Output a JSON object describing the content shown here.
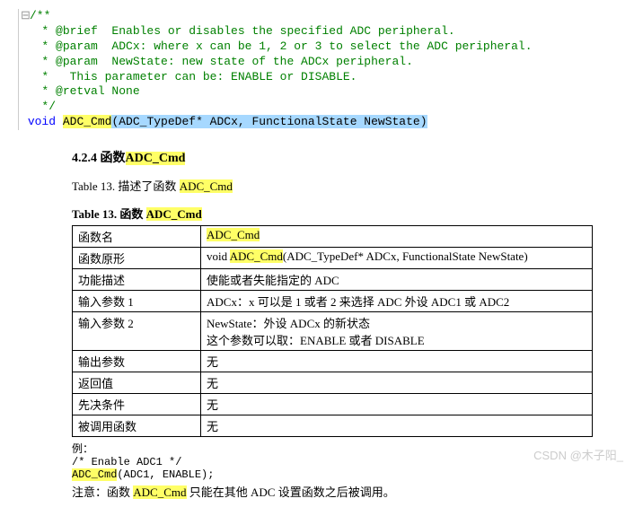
{
  "code": {
    "gutter_mark": "⊟",
    "l1": "/**",
    "l2": "  * @brief  Enables or disables the specified ADC peripheral.",
    "l3": "  * @param  ADCx: where x can be 1, 2 or 3 to select the ADC peripheral.",
    "l4": "  * @param  NewState: new state of the ADCx peripheral.",
    "l5": "  *   This parameter can be: ENABLE or DISABLE.",
    "l6": "  * @retval None",
    "l7": "  */",
    "sig_kw": "void",
    "sig_sp": " ",
    "sig_fn": "ADC_Cmd",
    "sig_args": "(ADC_TypeDef* ADCx, FunctionalState NewState)"
  },
  "section": {
    "num": "4.2.4",
    "prefix": "函数",
    "name": "ADC_Cmd"
  },
  "caption_sentence": {
    "pre": "Table 13.  描述了函数 ",
    "hl": "ADC_Cmd"
  },
  "table_caption": {
    "pre": "Table 13.  函数 ",
    "hl": "ADC_Cmd"
  },
  "table": {
    "rows": [
      [
        "函数名",
        ""
      ],
      [
        "函数原形",
        ""
      ],
      [
        "功能描述",
        "使能或者失能指定的 ADC"
      ],
      [
        "输入参数 1",
        "ADCx：x 可以是 1 或者 2 来选择 ADC 外设 ADC1 或 ADC2"
      ],
      [
        "输入参数 2",
        "NewState：外设 ADCx 的新状态\n这个参数可以取：ENABLE 或者 DISABLE"
      ],
      [
        "输出参数",
        "无"
      ],
      [
        "返回值",
        "无"
      ],
      [
        "先决条件",
        "无"
      ],
      [
        "被调用函数",
        "无"
      ]
    ],
    "row0_value_hl": "ADC_Cmd",
    "row1_value_pre": "void ",
    "row1_value_hl": "ADC_Cmd",
    "row1_value_post": "(ADC_TypeDef* ADCx, FunctionalState NewState)"
  },
  "example": {
    "head": "例：",
    "comment": "/* Enable ADC1 */",
    "call_fn": "ADC_Cmd",
    "call_rest": "(ADC1, ENABLE);"
  },
  "note": {
    "pre": "注意：函数 ",
    "hl": "ADC_Cmd",
    "post": " 只能在其他 ADC 设置函数之后被调用。"
  },
  "watermark": "CSDN @木子阳_"
}
